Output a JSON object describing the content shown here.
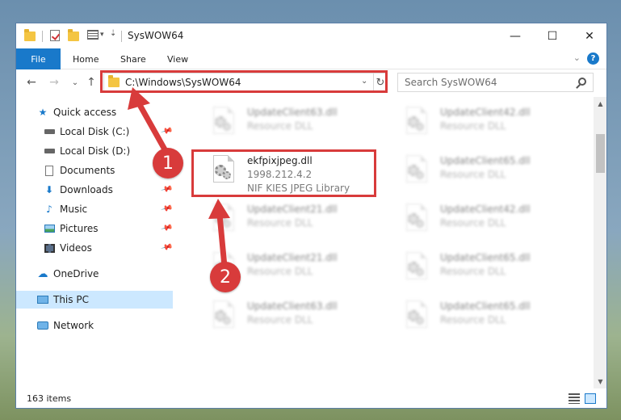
{
  "window": {
    "title": "SysWOW64",
    "minimize": "—",
    "maximize": "☐",
    "close": "✕"
  },
  "ribbon": {
    "tabs": [
      "File",
      "Home",
      "Share",
      "View"
    ],
    "help": "?",
    "collapse": "⌄"
  },
  "nav": {
    "back": "←",
    "forward": "→",
    "recent": "⌄",
    "up": "↑",
    "address": "C:\\Windows\\SysWOW64",
    "address_dropdown": "⌄",
    "refresh": "↻",
    "search_placeholder": "Search SysWOW64"
  },
  "sidebar": {
    "items": [
      {
        "label": "Quick access",
        "icon": "star-icon",
        "pinned": false
      },
      {
        "label": "Local Disk (C:)",
        "icon": "drive-icon",
        "pinned": true
      },
      {
        "label": "Local Disk (D:)",
        "icon": "drive-icon",
        "pinned": false
      },
      {
        "label": "Documents",
        "icon": "documents-icon",
        "pinned": true
      },
      {
        "label": "Downloads",
        "icon": "download-icon",
        "pinned": true
      },
      {
        "label": "Music",
        "icon": "music-icon",
        "pinned": true
      },
      {
        "label": "Pictures",
        "icon": "pictures-icon",
        "pinned": true
      },
      {
        "label": "Videos",
        "icon": "videos-icon",
        "pinned": true
      },
      {
        "label": "OneDrive",
        "icon": "cloud-icon",
        "pinned": false
      },
      {
        "label": "This PC",
        "icon": "computer-icon",
        "pinned": false,
        "selected": true
      },
      {
        "label": "Network",
        "icon": "network-icon",
        "pinned": false
      }
    ]
  },
  "files": {
    "highlighted": {
      "name": "ekfpixjpeg.dll",
      "version": "1998.212.4.2",
      "description": "NIF KIES JPEG Library"
    },
    "col1": [
      {
        "name": "UpdateClient63.dll",
        "type": "Resource DLL"
      },
      {
        "name": "UpdateClient21.dll",
        "type": "Resource DLL"
      },
      {
        "name": "UpdateClient21.dll",
        "type": "Resource DLL"
      },
      {
        "name": "UpdateClient63.dll",
        "type": "Resource DLL"
      }
    ],
    "col2": [
      {
        "name": "UpdateClient42.dll",
        "type": "Resource DLL"
      },
      {
        "name": "UpdateClient65.dll",
        "type": "Resource DLL"
      },
      {
        "name": "UpdateClient42.dll",
        "type": "Resource DLL"
      },
      {
        "name": "UpdateClient65.dll",
        "type": "Resource DLL"
      },
      {
        "name": "UpdateClient65.dll",
        "type": "Resource DLL"
      }
    ]
  },
  "status": {
    "count": "163 items"
  },
  "annotations": {
    "badge1": "1",
    "badge2": "2",
    "color": "#d83b3b"
  }
}
